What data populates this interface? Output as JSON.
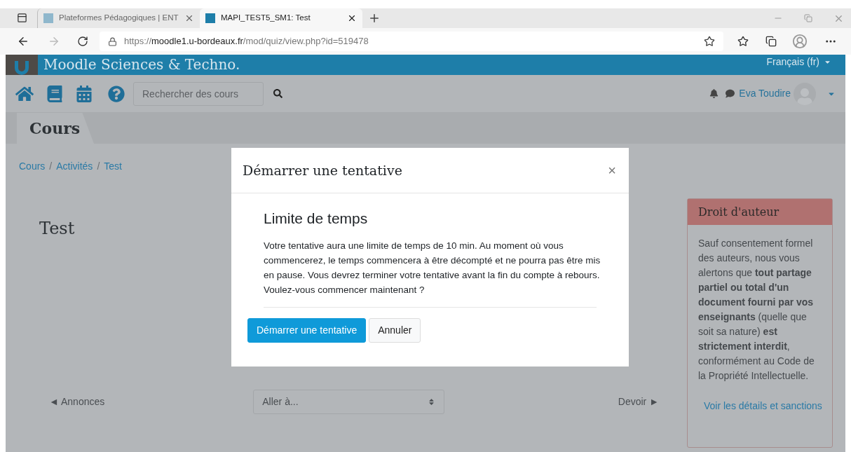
{
  "browser": {
    "tabs": [
      {
        "title": "Plateformes Pédagogiques | ENT",
        "selected": false
      },
      {
        "title": "MAPI_TEST5_SM1: Test",
        "selected": true
      }
    ],
    "url": {
      "scheme": "https://",
      "host": "moodle1.u-bordeaux.fr",
      "path": "/mod/quiz/view.php?id=519478"
    }
  },
  "site": {
    "title": "Moodle Sciences & Techno.",
    "language": "Français (fr)",
    "search_placeholder": "Rechercher des cours",
    "user": "Eva Toudire"
  },
  "page": {
    "section": "Cours",
    "breadcrumb": [
      "Cours",
      "Activités",
      "Test"
    ],
    "breadcrumb_separator": "/",
    "heading": "Test",
    "prev_link": "◄ Annonces",
    "jump_placeholder": "Aller à...",
    "next_link": "Devoir ►"
  },
  "block": {
    "title": "Droit d'auteur",
    "text": "Sauf consentement formel des auteurs, nous vous alertons que **tout partage partiel ou total d'un document fourni par vos enseignants** (quelle que soit sa nature) **est strictement interdit**, conformément au Code de la Propriété Intellectuelle.",
    "link": "Voir les détails et sanctions"
  },
  "modal": {
    "title": "Démarrer une tentative",
    "close": "×",
    "subtitle": "Limite de temps",
    "text": "Votre tentative aura une limite de temps de 10 min. Au moment où vous commencerez, le temps commencera à être décompté et ne pourra pas être mis en pause. Vous devrez terminer votre tentative avant la fin du compte à rebours. Voulez-vous commencer maintenant ?",
    "buttons": [
      {
        "label": "Démarrer une tentative",
        "kind": "primary"
      },
      {
        "label": "Annuler",
        "kind": "secondary"
      }
    ]
  }
}
